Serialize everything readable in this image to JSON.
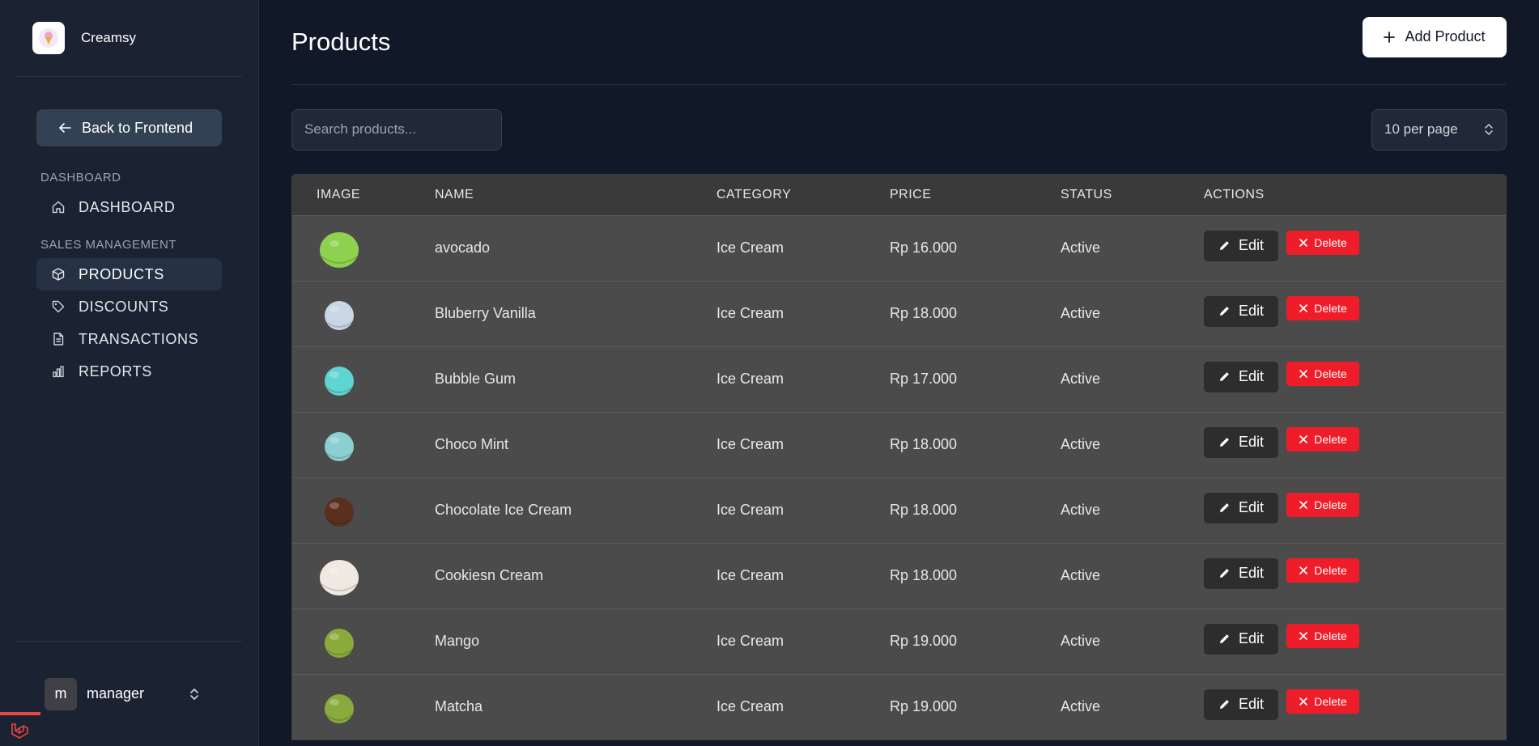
{
  "brand": {
    "name": "Creamsy"
  },
  "sidebar": {
    "back_label": "Back to Frontend",
    "sections": [
      {
        "label": "DASHBOARD",
        "items": [
          {
            "label": "DASHBOARD",
            "icon": "home-icon"
          }
        ]
      },
      {
        "label": "SALES MANAGEMENT",
        "items": [
          {
            "label": "PRODUCTS",
            "icon": "box-icon",
            "active": true
          },
          {
            "label": "DISCOUNTS",
            "icon": "tag-icon"
          },
          {
            "label": "TRANSACTIONS",
            "icon": "document-icon"
          },
          {
            "label": "REPORTS",
            "icon": "bar-chart-icon"
          }
        ]
      }
    ],
    "user": {
      "initial": "m",
      "name": "manager"
    }
  },
  "header": {
    "title": "Products",
    "add_label": "Add Product"
  },
  "toolbar": {
    "search_placeholder": "Search products...",
    "per_page": "10 per page"
  },
  "table": {
    "columns": [
      "IMAGE",
      "NAME",
      "CATEGORY",
      "PRICE",
      "STATUS",
      "ACTIONS"
    ],
    "edit_label": "Edit",
    "delete_label": "Delete",
    "rows": [
      {
        "name": "avocado",
        "category": "Ice Cream",
        "price": "Rp 16.000",
        "status": "Active",
        "scoop_color": "#8ed14f"
      },
      {
        "name": "Bluberry Vanilla",
        "category": "Ice Cream",
        "price": "Rp 18.000",
        "status": "Active",
        "scoop_color": "#c8d6e6"
      },
      {
        "name": "Bubble Gum",
        "category": "Ice Cream",
        "price": "Rp 17.000",
        "status": "Active",
        "scoop_color": "#5fd4d1"
      },
      {
        "name": "Choco Mint",
        "category": "Ice Cream",
        "price": "Rp 18.000",
        "status": "Active",
        "scoop_color": "#8ccfd3"
      },
      {
        "name": "Chocolate Ice Cream",
        "category": "Ice Cream",
        "price": "Rp 18.000",
        "status": "Active",
        "scoop_color": "#5a2f1e"
      },
      {
        "name": "Cookiesn Cream",
        "category": "Ice Cream",
        "price": "Rp 18.000",
        "status": "Active",
        "scoop_color": "#efe9e1"
      },
      {
        "name": "Mango",
        "category": "Ice Cream",
        "price": "Rp 19.000",
        "status": "Active",
        "scoop_color": "#8aab3b"
      },
      {
        "name": "Matcha",
        "category": "Ice Cream",
        "price": "Rp 19.000",
        "status": "Active",
        "scoop_color": "#89aa3c"
      }
    ]
  }
}
